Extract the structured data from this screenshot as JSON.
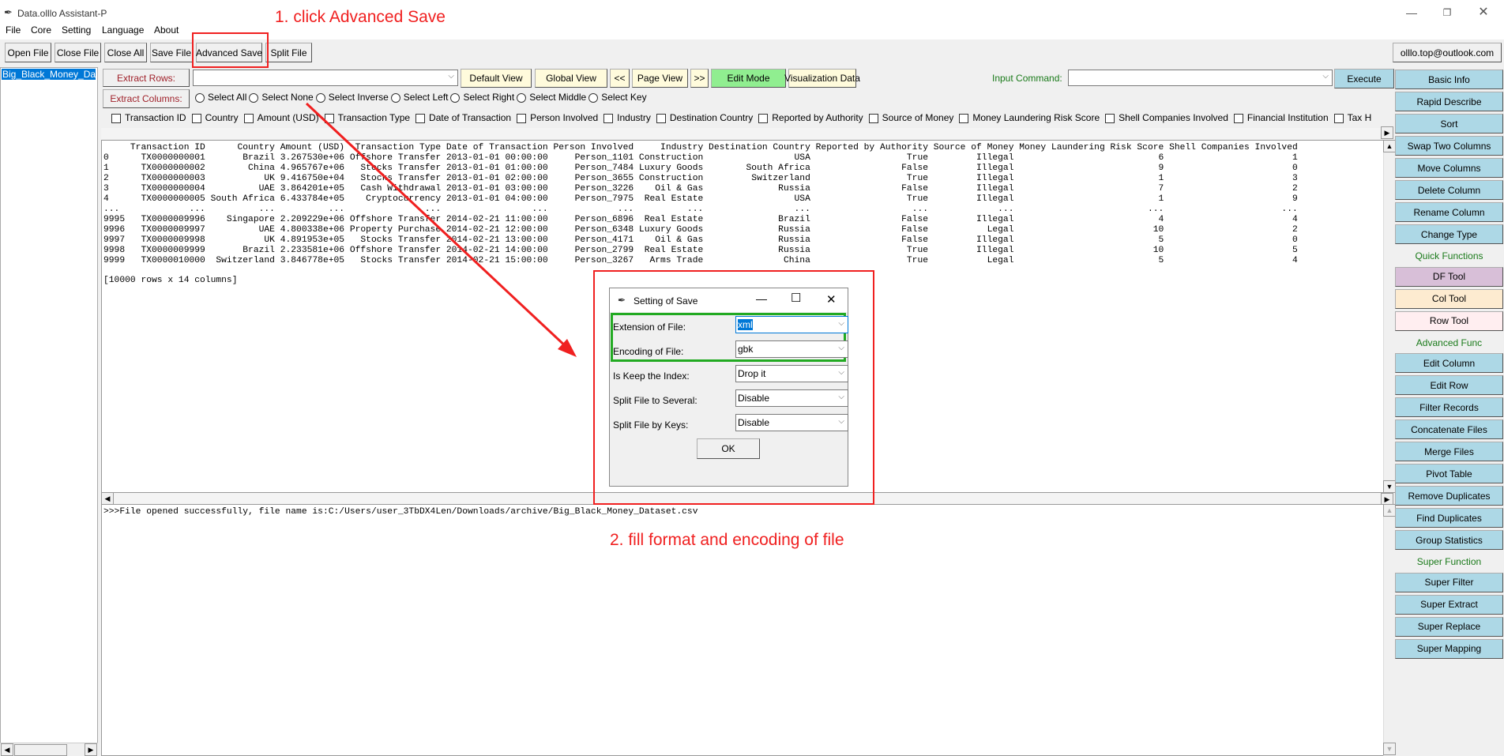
{
  "app": {
    "title": "Data.olllo Assistant-P",
    "icon": "feather-icon",
    "window_controls": [
      "minimize-icon",
      "restore-icon",
      "close-icon"
    ]
  },
  "menu": [
    "File",
    "Core",
    "Setting",
    "Language",
    "About"
  ],
  "toolbar": {
    "buttons": [
      "Open File",
      "Close File",
      "Close All",
      "Save File",
      "Advanced Save",
      "Split File"
    ],
    "account": "olllo.top@outlook.com"
  },
  "files": [
    "Big_Black_Money_Data"
  ],
  "extract": {
    "rows_label": "Extract Rows:",
    "rows_value": "",
    "columns_label": "Extract Columns:",
    "view_buttons": [
      "Default View",
      "Global View",
      "<<",
      "Page View",
      ">>",
      "Edit Mode",
      "Visualization Data"
    ],
    "radios": [
      "Select All",
      "Select None",
      "Select Inverse",
      "Select Left",
      "Select Right",
      "Select Middle",
      "Select Key"
    ]
  },
  "command": {
    "label": "Input Command:",
    "value": "",
    "execute": "Execute"
  },
  "columns": [
    "Transaction ID",
    "Country",
    "Amount (USD)",
    "Transaction Type",
    "Date of Transaction",
    "Person Involved",
    "Industry",
    "Destination Country",
    "Reported by Authority",
    "Source of Money",
    "Money Laundering Risk Score",
    "Shell Companies Involved",
    "Financial Institution",
    "Tax H"
  ],
  "table": {
    "header": [
      "",
      "Transaction ID",
      "Country",
      "Amount (USD)",
      "Transaction Type",
      "Date of Transaction",
      "Person Involved",
      "Industry",
      "Destination Country",
      "Reported by Authority",
      "Source of Money",
      "Money Laundering Risk Score",
      "Shell Companies Involved"
    ],
    "rows": [
      [
        "0",
        "TX0000000001",
        "Brazil",
        "3.267530e+06",
        "Offshore Transfer",
        "2013-01-01 00:00:00",
        "Person_1101",
        "Construction",
        "USA",
        "True",
        "Illegal",
        "6",
        "1"
      ],
      [
        "1",
        "TX0000000002",
        "China",
        "4.965767e+06",
        "Stocks Transfer",
        "2013-01-01 01:00:00",
        "Person_7484",
        "Luxury Goods",
        "South Africa",
        "False",
        "Illegal",
        "9",
        "0"
      ],
      [
        "2",
        "TX0000000003",
        "UK",
        "9.416750e+04",
        "Stocks Transfer",
        "2013-01-01 02:00:00",
        "Person_3655",
        "Construction",
        "Switzerland",
        "True",
        "Illegal",
        "1",
        "3"
      ],
      [
        "3",
        "TX0000000004",
        "UAE",
        "3.864201e+05",
        "Cash Withdrawal",
        "2013-01-01 03:00:00",
        "Person_3226",
        "Oil & Gas",
        "Russia",
        "False",
        "Illegal",
        "7",
        "2"
      ],
      [
        "4",
        "TX0000000005",
        "South Africa",
        "6.433784e+05",
        "Cryptocurrency",
        "2013-01-01 04:00:00",
        "Person_7975",
        "Real Estate",
        "USA",
        "True",
        "Illegal",
        "1",
        "9"
      ],
      [
        "...",
        "...",
        "...",
        "...",
        "...",
        "...",
        "...",
        "...",
        "...",
        "...",
        "...",
        "...",
        "..."
      ],
      [
        "9995",
        "TX0000009996",
        "Singapore",
        "2.209229e+06",
        "Offshore Transfer",
        "2014-02-21 11:00:00",
        "Person_6896",
        "Real Estate",
        "Brazil",
        "False",
        "Illegal",
        "4",
        "4"
      ],
      [
        "9996",
        "TX0000009997",
        "UAE",
        "4.800338e+06",
        "Property Purchase",
        "2014-02-21 12:00:00",
        "Person_6348",
        "Luxury Goods",
        "Russia",
        "False",
        "Legal",
        "10",
        "2"
      ],
      [
        "9997",
        "TX0000009998",
        "UK",
        "4.891953e+05",
        "Stocks Transfer",
        "2014-02-21 13:00:00",
        "Person_4171",
        "Oil & Gas",
        "Russia",
        "False",
        "Illegal",
        "5",
        "0"
      ],
      [
        "9998",
        "TX0000009999",
        "Brazil",
        "2.233581e+06",
        "Offshore Transfer",
        "2014-02-21 14:00:00",
        "Person_2799",
        "Real Estate",
        "Russia",
        "True",
        "Illegal",
        "10",
        "5"
      ],
      [
        "9999",
        "TX0000010000",
        "Switzerland",
        "3.846778e+05",
        "Stocks Transfer",
        "2014-02-21 15:00:00",
        "Person_3267",
        "Arms Trade",
        "China",
        "True",
        "Legal",
        "5",
        "4"
      ]
    ],
    "summary": "[10000 rows x 14 columns]"
  },
  "log": ">>>File opened successfully, file name is:C:/Users/user_3TbDX4Len/Downloads/archive/Big_Black_Money_Dataset.csv",
  "side_panel": [
    {
      "type": "button",
      "label": "Basic Info",
      "color": "blue"
    },
    {
      "type": "button",
      "label": "Rapid Describe",
      "color": "blue"
    },
    {
      "type": "button",
      "label": "Sort",
      "color": "blue"
    },
    {
      "type": "button",
      "label": "Swap Two Columns",
      "color": "blue"
    },
    {
      "type": "button",
      "label": "Move Columns",
      "color": "blue"
    },
    {
      "type": "button",
      "label": "Delete Column",
      "color": "blue"
    },
    {
      "type": "button",
      "label": "Rename Column",
      "color": "blue"
    },
    {
      "type": "button",
      "label": "Change Type",
      "color": "blue"
    },
    {
      "type": "label",
      "label": "Quick Functions"
    },
    {
      "type": "button",
      "label": "DF Tool",
      "color": "purple"
    },
    {
      "type": "button",
      "label": "Col Tool",
      "color": "peach"
    },
    {
      "type": "button",
      "label": "Row Tool",
      "color": "pink"
    },
    {
      "type": "label",
      "label": "Advanced Func"
    },
    {
      "type": "button",
      "label": "Edit Column",
      "color": "blue"
    },
    {
      "type": "button",
      "label": "Edit Row",
      "color": "blue"
    },
    {
      "type": "button",
      "label": "Filter Records",
      "color": "blue"
    },
    {
      "type": "button",
      "label": "Concatenate Files",
      "color": "blue"
    },
    {
      "type": "button",
      "label": "Merge Files",
      "color": "blue"
    },
    {
      "type": "button",
      "label": "Pivot Table",
      "color": "blue"
    },
    {
      "type": "button",
      "label": "Remove Duplicates",
      "color": "blue"
    },
    {
      "type": "button",
      "label": "Find Duplicates",
      "color": "blue"
    },
    {
      "type": "button",
      "label": "Group Statistics",
      "color": "blue"
    },
    {
      "type": "label",
      "label": "Super Function"
    },
    {
      "type": "button",
      "label": "Super Filter",
      "color": "blue"
    },
    {
      "type": "button",
      "label": "Super Extract",
      "color": "blue"
    },
    {
      "type": "button",
      "label": "Super Replace",
      "color": "blue"
    },
    {
      "type": "button",
      "label": "Super Mapping",
      "color": "blue"
    }
  ],
  "dialog": {
    "title": "Setting of Save",
    "fields": [
      {
        "label": "Extension of File:",
        "value": "xml"
      },
      {
        "label": "Encoding of File:",
        "value": "gbk"
      },
      {
        "label": "Is Keep the Index:",
        "value": "Drop it"
      },
      {
        "label": "Split File to Several:",
        "value": "Disable"
      },
      {
        "label": "Split File by Keys:",
        "value": "Disable"
      }
    ],
    "ok": "OK"
  },
  "annotations": {
    "step1": "1. click Advanced Save",
    "step2": "2. fill format and encoding of file"
  },
  "colors": {
    "annotation_red": "#f02020",
    "highlight_green": "#22aa22",
    "selection_blue": "#0078d7",
    "button_blue": "#add8e6",
    "edit_mode_green": "#90ee90",
    "view_yellow": "#fffbdc",
    "section_label_green": "#1a7a1a",
    "label_red": "#a0222b"
  }
}
